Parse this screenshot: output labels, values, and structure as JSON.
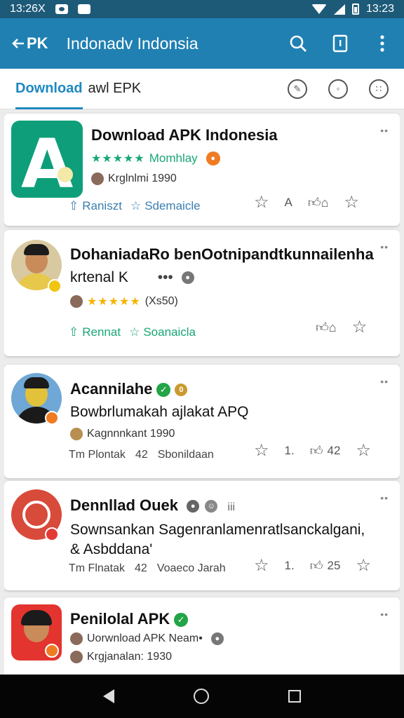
{
  "status_bar": {
    "time_left": "13:26X",
    "time_right": "13:23"
  },
  "app_bar": {
    "back_label": "PK",
    "title": "Indonadv Indonsia"
  },
  "tabs": {
    "active": "Download",
    "secondary": "awl EPK"
  },
  "cards": [
    {
      "title": "Download APK Indonesia",
      "rating_label": "Momhlay",
      "meta": "Krglnlmi 1990",
      "action1": "Raniszt",
      "action2": "Sdemaicle",
      "right_count": "A"
    },
    {
      "title_line1": "DohaniadaRo benOotnipandtkunnailenha",
      "title_line2": "krtenal K",
      "title_ellipsis": "•••",
      "meta": "(Xs50)",
      "action1": "Rennat",
      "action2": "Soanaicla"
    },
    {
      "title": "Acannilahe",
      "desc": "Bowbrlumakah ajlakat APQ",
      "meta": "Kagnnnkant 1990",
      "footer_left": "Tm Plontak",
      "footer_mid": "42",
      "footer_right": "Sbonildaan",
      "count_a": "1.",
      "count_b": "42"
    },
    {
      "title": "Dennllad Ouek",
      "title_extra": "iii",
      "desc_line1": "Sownsankan Sagenranlamenratlsanckalgani,",
      "desc_line2": "& Asbddana'",
      "footer_left": "Tm Flnatak",
      "footer_mid": "42",
      "footer_right": "Voaeco Jarah",
      "count_a": "1.",
      "count_b": "25"
    },
    {
      "title": "Penilolal APK",
      "meta1": "Uorwnload APK Neam•",
      "meta2": "Krgjanalan: 1930"
    }
  ],
  "colors": {
    "status_bar": "#1d5a78",
    "app_bar": "#2080b2",
    "accent": "#1e88c0",
    "green": "#19a774",
    "verified": "#22a447"
  },
  "icons": [
    "search-icon",
    "info-icon",
    "more-vert-icon",
    "chat-bubble-icon",
    "comment-icon",
    "emoji-icon",
    "repost-icon",
    "star-icon",
    "thumb-up-icon"
  ]
}
